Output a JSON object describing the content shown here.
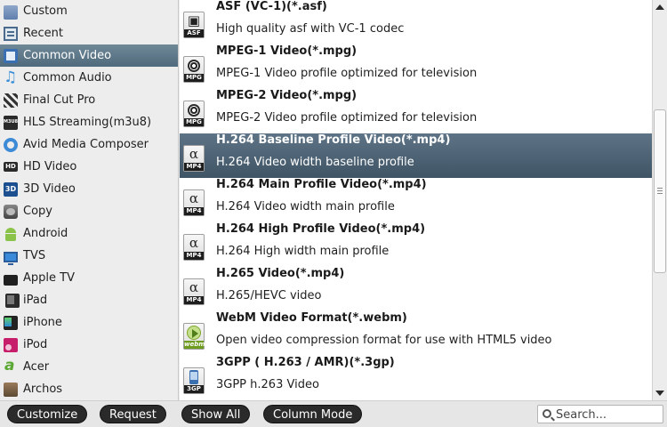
{
  "sidebar": {
    "items": [
      {
        "label": "Custom",
        "icon": "folder-icon",
        "selected": false
      },
      {
        "label": "Recent",
        "icon": "recent-icon",
        "selected": false
      },
      {
        "label": "Common Video",
        "icon": "film-icon",
        "selected": true
      },
      {
        "label": "Common Audio",
        "icon": "music-note-icon",
        "selected": false
      },
      {
        "label": "Final Cut Pro",
        "icon": "clapperboard-icon",
        "selected": false
      },
      {
        "label": "HLS Streaming(m3u8)",
        "icon": "hls-icon",
        "badge": "M3U8",
        "selected": false
      },
      {
        "label": "Avid Media Composer",
        "icon": "avid-icon",
        "selected": false
      },
      {
        "label": "HD Video",
        "icon": "hd-icon",
        "badge": "HD",
        "selected": false
      },
      {
        "label": "3D Video",
        "icon": "3d-icon",
        "badge": "3D",
        "selected": false
      },
      {
        "label": "Copy",
        "icon": "copy-icon",
        "selected": false
      },
      {
        "label": "Android",
        "icon": "android-icon",
        "selected": false
      },
      {
        "label": "TVS",
        "icon": "tv-icon",
        "selected": false
      },
      {
        "label": "Apple TV",
        "icon": "apple-tv-icon",
        "selected": false
      },
      {
        "label": "iPad",
        "icon": "ipad-icon",
        "selected": false
      },
      {
        "label": "iPhone",
        "icon": "iphone-icon",
        "selected": false
      },
      {
        "label": "iPod",
        "icon": "ipod-icon",
        "selected": false
      },
      {
        "label": "Acer",
        "icon": "acer-icon",
        "selected": false
      },
      {
        "label": "Archos",
        "icon": "archos-icon",
        "selected": false
      }
    ]
  },
  "formats": [
    {
      "title": "ASF (VC-1)(*.asf)",
      "desc": "High quality asf with VC-1 codec",
      "badge": "ASF",
      "icon": "asf-format-icon",
      "selected": false
    },
    {
      "title": "MPEG-1 Video(*.mpg)",
      "desc": "MPEG-1 Video profile optimized for television",
      "badge": "MPG",
      "icon": "mpg-format-icon",
      "selected": false
    },
    {
      "title": "MPEG-2 Video(*.mpg)",
      "desc": "MPEG-2 Video profile optimized for television",
      "badge": "MPG",
      "icon": "mpg-format-icon",
      "selected": false
    },
    {
      "title": "H.264 Baseline Profile Video(*.mp4)",
      "desc": "H.264 Video width baseline profile",
      "badge": "MP4",
      "icon": "mp4-format-icon",
      "selected": true
    },
    {
      "title": "H.264 Main Profile Video(*.mp4)",
      "desc": "H.264 Video width main profile",
      "badge": "MP4",
      "icon": "mp4-format-icon",
      "selected": false
    },
    {
      "title": "H.264 High Profile Video(*.mp4)",
      "desc": "H.264 High width main profile",
      "badge": "MP4",
      "icon": "mp4-format-icon",
      "selected": false
    },
    {
      "title": "H.265 Video(*.mp4)",
      "desc": "H.265/HEVC video",
      "badge": "MP4",
      "icon": "mp4-format-icon",
      "selected": false
    },
    {
      "title": "WebM Video Format(*.webm)",
      "desc": "Open video compression format for use with HTML5 video",
      "badge": "webm",
      "icon": "webm-format-icon",
      "selected": false
    },
    {
      "title": "3GPP ( H.263 / AMR)(*.3gp)",
      "desc": "3GPP h.263 Video",
      "badge": "3GP",
      "icon": "3gp-format-icon",
      "selected": false
    }
  ],
  "toolbar": {
    "customize_label": "Customize",
    "request_label": "Request",
    "show_all_label": "Show All",
    "column_mode_label": "Column Mode"
  },
  "search": {
    "placeholder": "Search...",
    "value": ""
  }
}
